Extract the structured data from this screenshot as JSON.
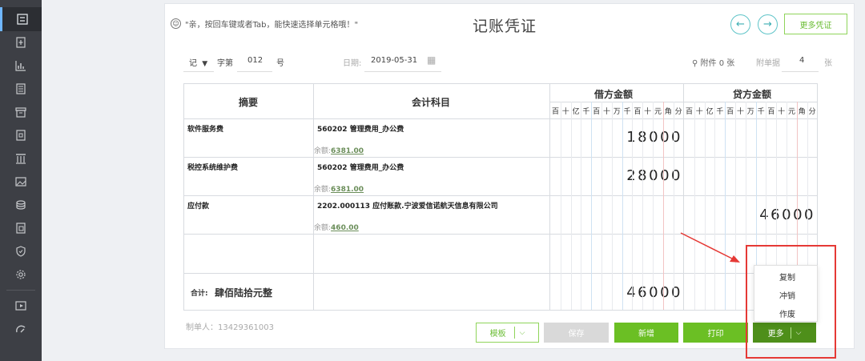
{
  "header": {
    "tip": "\"亲，按回车键或者Tab，能快速选择单元格哦！\"",
    "title": "记账凭证",
    "prev_icon": "arrow-left-icon",
    "next_icon": "arrow-right-icon",
    "more_vouchers": "更多凭证"
  },
  "meta": {
    "voucher_type": "记",
    "zi_label": "字第",
    "number": "012",
    "hao_label": "号",
    "date_label": "日期:",
    "date_value": "2019-05-31",
    "attachment_label": "附件 0 张",
    "attach_docs_label": "附单据",
    "attach_docs_value": "4",
    "zhang_label": "张"
  },
  "table": {
    "headers": {
      "summary": "摘要",
      "account": "会计科目",
      "debit": "借方金额",
      "credit": "贷方金额"
    },
    "digit_labels": [
      "百",
      "十",
      "亿",
      "千",
      "百",
      "十",
      "万",
      "千",
      "百",
      "十",
      "元",
      "角",
      "分"
    ],
    "rows": [
      {
        "summary": "软件服务费",
        "account": "560202 管理费用_办公费",
        "balance_label": "余额:",
        "balance": "6381.00",
        "debit": "18000",
        "credit": ""
      },
      {
        "summary": "税控系统维护费",
        "account": "560202 管理费用_办公费",
        "balance_label": "余额:",
        "balance": "6381.00",
        "debit": "28000",
        "credit": ""
      },
      {
        "summary": "应付款",
        "account": "2202.000113 应付账款.宁波爱信诺航天信息有限公司",
        "balance_label": "余额:",
        "balance": "460.00",
        "debit": "",
        "credit": "46000"
      }
    ],
    "total": {
      "label": "合计:",
      "words": "肆佰陆拾元整",
      "debit": "46000"
    }
  },
  "footer": {
    "creator": "制单人：13429361003",
    "template": "模板",
    "save": "保存",
    "add": "新增",
    "print": "打印",
    "more": "更多"
  },
  "more_menu": [
    "复制",
    "冲销",
    "作废"
  ],
  "colors": {
    "accent_green": "#6bbf24",
    "dark_green": "#4e8f1a",
    "teal": "#3daeb3",
    "annotation_red": "#e53935",
    "sidebar": "#3d3f45"
  }
}
